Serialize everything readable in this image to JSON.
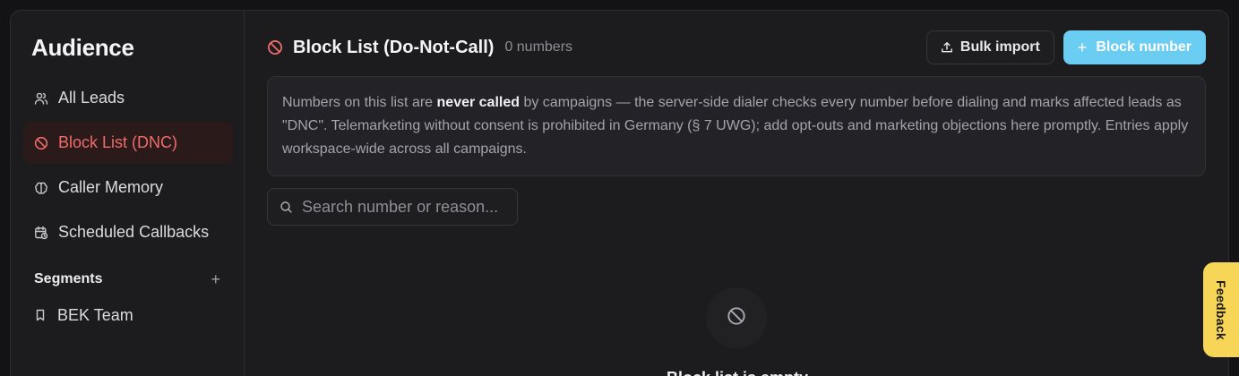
{
  "sidebar": {
    "title": "Audience",
    "items": [
      {
        "label": "All Leads",
        "icon": "users-icon"
      },
      {
        "label": "Block List (DNC)",
        "icon": "ban-icon",
        "active": true
      },
      {
        "label": "Caller Memory",
        "icon": "brain-icon"
      },
      {
        "label": "Scheduled Callbacks",
        "icon": "calendar-clock-icon"
      }
    ],
    "segments_label": "Segments",
    "segments_add": "+",
    "segments": [
      {
        "label": "BEK Team",
        "icon": "bookmark-icon"
      }
    ]
  },
  "header": {
    "title": "Block List (Do-Not-Call)",
    "count": "0 numbers",
    "bulk_import_label": "Bulk import",
    "block_number_label": "Block number"
  },
  "notice": {
    "prefix": "Numbers on this list are ",
    "emphasis": "never called",
    "suffix": " by campaigns — the server-side dialer checks every number before dialing and marks affected leads as \"DNC\". Telemarketing without consent is prohibited in Germany (§ 7 UWG); add opt-outs and marketing objections here promptly. Entries apply workspace-wide across all campaigns."
  },
  "search": {
    "placeholder": "Search number or reason..."
  },
  "empty_state": {
    "title": "Block list is empty"
  },
  "feedback": {
    "label": "Feedback"
  },
  "colors": {
    "accent": "#6ccdf3",
    "danger": "#f06b6b",
    "feedback": "#f7d556"
  }
}
